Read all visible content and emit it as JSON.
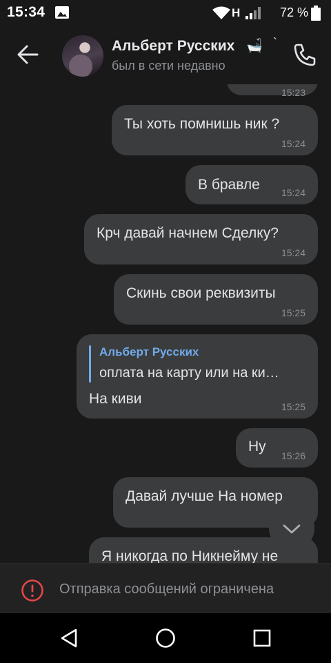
{
  "status_bar": {
    "time": "15:34",
    "network_type": "H",
    "battery_percent": "72 %"
  },
  "header": {
    "contact_name": "Альберт Русских",
    "name_emoji": "🛁",
    "name_tail": "`",
    "contact_status": "был в сети недавно",
    "icons": [
      "back-arrow-icon",
      "avatar",
      "phone-icon"
    ]
  },
  "messages": [
    {
      "text": "",
      "time": "15:23",
      "partial": true
    },
    {
      "text": "Ты хоть помнишь ник ?",
      "time": "15:24"
    },
    {
      "text": "В бравле",
      "time": "15:24"
    },
    {
      "text": "Крч давай начнем Сделку?",
      "time": "15:24"
    },
    {
      "text": "Скинь свои реквизиты",
      "time": "15:25"
    },
    {
      "reply_author": "Альберт Русских",
      "reply_text": "оплата на карту или на ки…",
      "text": "На киви",
      "time": "15:25"
    },
    {
      "text": "Ну",
      "time": "15:26"
    },
    {
      "text": "Давай лучше На номер",
      "time": ""
    },
    {
      "text": "Я никогда по Никнейму не",
      "time": "",
      "partial": true
    }
  ],
  "restriction": {
    "text": "Отправка сообщений ограничена",
    "icon": "warning-circle-icon"
  },
  "colors": {
    "background": "#19191a",
    "bubble": "#3b3c3d",
    "accent": "#71aaeb",
    "warning": "#e64646"
  }
}
